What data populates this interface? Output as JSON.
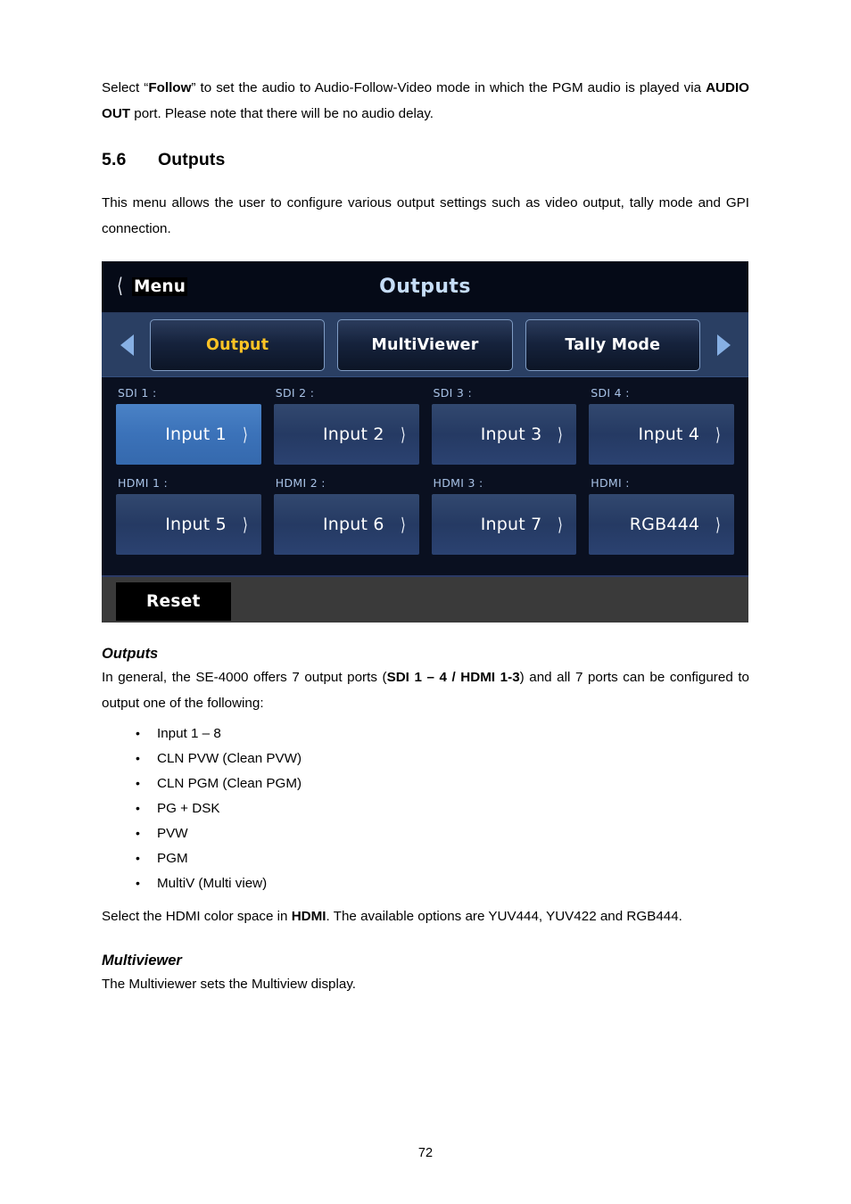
{
  "document": {
    "page_number": "72"
  },
  "intro": {
    "line_prefix": "Select “",
    "bold_follow": "Follow",
    "line_mid": "” to set the audio to Audio-Follow-Video mode in which the PGM audio is played via ",
    "bold_audio_out": "AUDIO OUT",
    "line_suffix": " port. Please note that there will be no audio delay."
  },
  "section": {
    "number": "5.6",
    "title": "Outputs",
    "description": "This menu allows the user to configure various output settings such as video output, tally mode and GPI connection."
  },
  "device_ui": {
    "header": {
      "back_label": "Menu",
      "back_icon": "chevron-left-icon",
      "title": "Outputs"
    },
    "tabs": {
      "prev_icon": "triangle-left-icon",
      "next_icon": "triangle-right-icon",
      "items": [
        {
          "label": "Output",
          "active": true
        },
        {
          "label": "MultiViewer",
          "active": false
        },
        {
          "label": "Tally Mode",
          "active": false
        }
      ],
      "active_color": "#ffc325"
    },
    "outputs": {
      "rows": [
        [
          {
            "label": "SDI 1 :",
            "value": "Input 1",
            "selected": true
          },
          {
            "label": "SDI 2 :",
            "value": "Input 2",
            "selected": false
          },
          {
            "label": "SDI 3 :",
            "value": "Input 3",
            "selected": false
          },
          {
            "label": "SDI 4 :",
            "value": "Input 4",
            "selected": false
          }
        ],
        [
          {
            "label": "HDMI 1 :",
            "value": "Input 5",
            "selected": false
          },
          {
            "label": "HDMI 2 :",
            "value": "Input 6",
            "selected": false
          },
          {
            "label": "HDMI 3 :",
            "value": "Input 7",
            "selected": false
          },
          {
            "label": "HDMI :",
            "value": "RGB444",
            "selected": false
          }
        ]
      ],
      "chevron_icon": "chevron-right-icon"
    },
    "footer": {
      "reset_label": "Reset"
    },
    "colors": {
      "header_bg": "#050a17",
      "tabbar_bg": "#2a3f63",
      "body_top": "#15264d",
      "body_bottom": "#1d3d7c",
      "selected_button": "#3b72b9",
      "unselected_button": "#2b4271",
      "footer_bg": "#3a3a3a",
      "title_text": "#c6ddf7",
      "label_text": "#a8c2e6",
      "arrow": "#87b0e4"
    }
  },
  "outputs_info": {
    "heading": "Outputs",
    "para_prefix": "In general, the SE-4000 offers 7 output ports (",
    "para_bold": "SDI 1 – 4 / HDMI 1-3",
    "para_suffix": ") and all 7 ports can be configured to output one of the following:",
    "bullets": [
      "Input 1 – 8",
      "CLN PVW (Clean PVW)",
      "CLN PGM (Clean PGM)",
      "PG + DSK",
      "PVW",
      "PGM",
      "MultiV (Multi view)"
    ],
    "colorspace_prefix": "Select the HDMI color space in ",
    "colorspace_bold": "HDMI",
    "colorspace_suffix": ". The available options are YUV444, YUV422 and RGB444."
  },
  "multiviewer_info": {
    "heading": "Multiviewer",
    "description": "The Multiviewer sets the Multiview display."
  }
}
